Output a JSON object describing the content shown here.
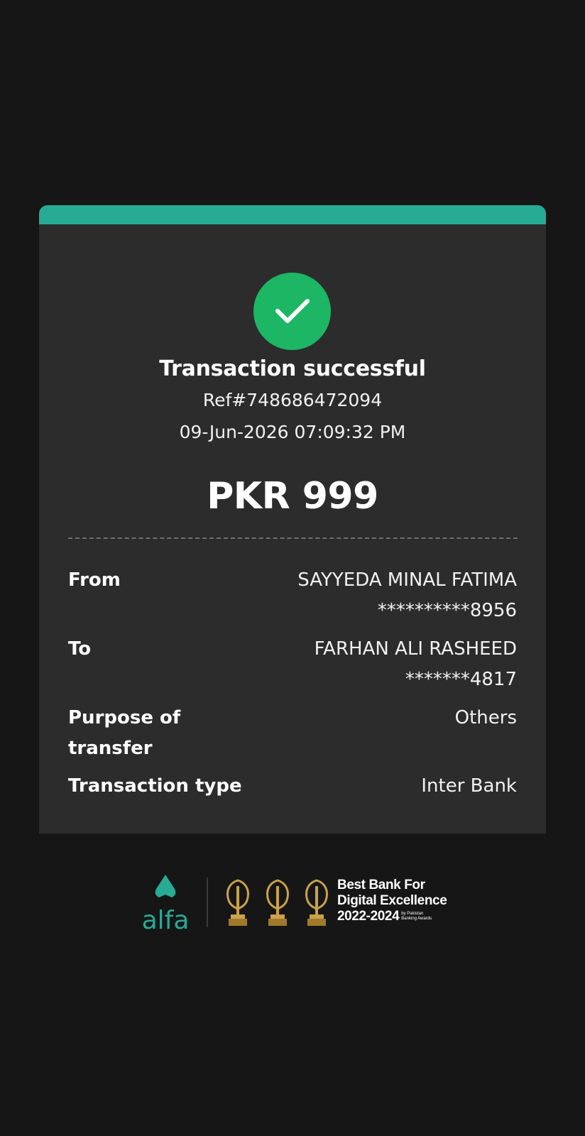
{
  "receipt": {
    "title": "Transaction successful",
    "ref": "Ref#748686472094",
    "datetime": "09-Jun-2026 07:09:32 PM",
    "amount": "PKR 999",
    "rows": [
      {
        "label": "From",
        "value_line1": "SAYYEDA MINAL FATIMA",
        "value_line2": "**********8956"
      },
      {
        "label": "To",
        "value_line1": "FARHAN ALI RASHEED",
        "value_line2": "*******4817"
      },
      {
        "label_line1": "Purpose of",
        "label_line2": "transfer",
        "value_line1": "Others"
      },
      {
        "label": "Transaction type",
        "value_line1": "Inter Bank"
      }
    ]
  },
  "footer": {
    "brand": "alfa",
    "award_line1": "Best Bank For",
    "award_line2": "Digital Excellence",
    "award_year": "2022-2024",
    "award_small_line1": "by Pakistan",
    "award_small_line2": "Banking Awards"
  },
  "colors": {
    "background": "#161616",
    "card": "#2c2c2c",
    "accent": "#27ab95",
    "success": "#1cb664",
    "gold": "#c9a24a"
  },
  "icons": {
    "status": "check-icon",
    "trophy": "trophy-icon",
    "logo": "alfa-logo"
  }
}
